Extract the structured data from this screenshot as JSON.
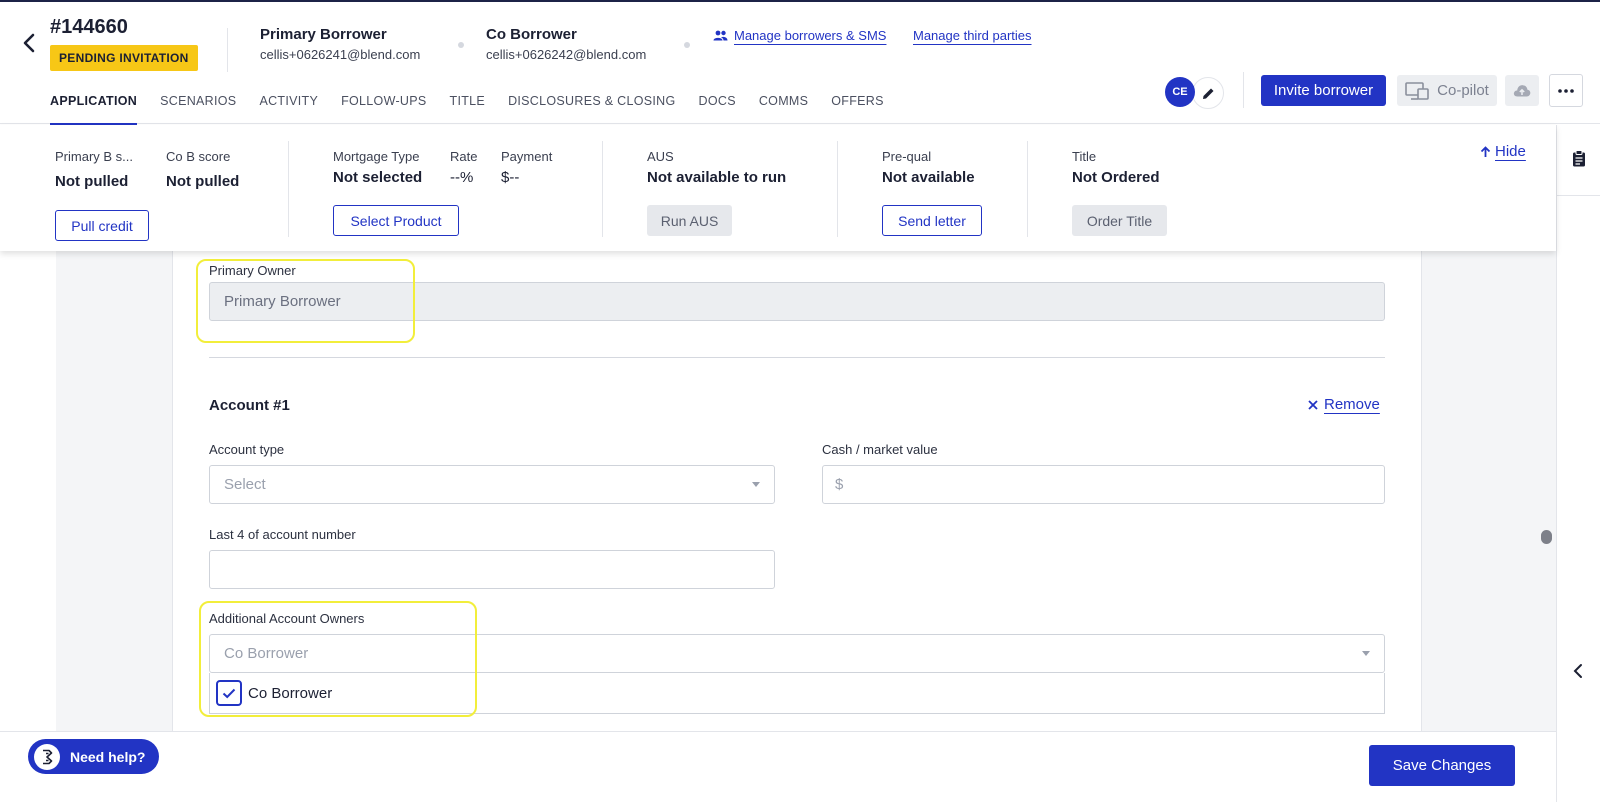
{
  "header": {
    "loan_id": "#144660",
    "status_badge": "PENDING INVITATION",
    "primary_borrower": {
      "role": "Primary Borrower",
      "email": "cellis+0626241@blend.com"
    },
    "co_borrower": {
      "role": "Co Borrower",
      "email": "cellis+0626242@blend.com"
    },
    "manage_borrowers_link": "Manage borrowers & SMS",
    "manage_third_parties_link": "Manage third parties",
    "tabs": [
      {
        "label": "APPLICATION",
        "active": true
      },
      {
        "label": "SCENARIOS"
      },
      {
        "label": "ACTIVITY"
      },
      {
        "label": "FOLLOW-UPS"
      },
      {
        "label": "TITLE"
      },
      {
        "label": "DISCLOSURES & CLOSING"
      },
      {
        "label": "DOCS"
      },
      {
        "label": "COMMS"
      },
      {
        "label": "OFFERS"
      }
    ],
    "avatar_initials": "CE",
    "invite_button": "Invite borrower",
    "copilot_button": "Co-pilot"
  },
  "summary": {
    "primary_score_label": "Primary B s...",
    "primary_score_value": "Not pulled",
    "co_score_label": "Co B score",
    "co_score_value": "Not pulled",
    "pull_credit_button": "Pull credit",
    "mortgage_type_label": "Mortgage Type",
    "mortgage_type_value": "Not selected",
    "rate_label": "Rate",
    "rate_value": "--%",
    "payment_label": "Payment",
    "payment_value": "$--",
    "select_product_button": "Select Product",
    "aus_label": "AUS",
    "aus_value": "Not available to run",
    "run_aus_button": "Run AUS",
    "prequal_label": "Pre-qual",
    "prequal_value": "Not available",
    "send_letter_button": "Send letter",
    "title_label": "Title",
    "title_value": "Not Ordered",
    "order_title_button": "Order Title",
    "hide_link": "Hide"
  },
  "form": {
    "primary_owner_label": "Primary Owner",
    "primary_owner_value": "Primary Borrower",
    "account_title": "Account #1",
    "remove_link": "Remove",
    "account_type_label": "Account type",
    "account_type_placeholder": "Select",
    "cash_value_label": "Cash / market value",
    "cash_value_prefix": "$",
    "last4_label": "Last 4 of account number",
    "last4_value": "",
    "additional_owners_label": "Additional Account Owners",
    "additional_owners_placeholder": "Co Borrower",
    "owner_options": [
      {
        "label": "Co Borrower",
        "checked": true
      }
    ]
  },
  "footer": {
    "help_button": "Need help?",
    "save_button": "Save Changes"
  },
  "colors": {
    "brand_blue": "#2234c4",
    "badge_yellow": "#f7c716",
    "highlight_yellow": "#f2ee3b"
  }
}
